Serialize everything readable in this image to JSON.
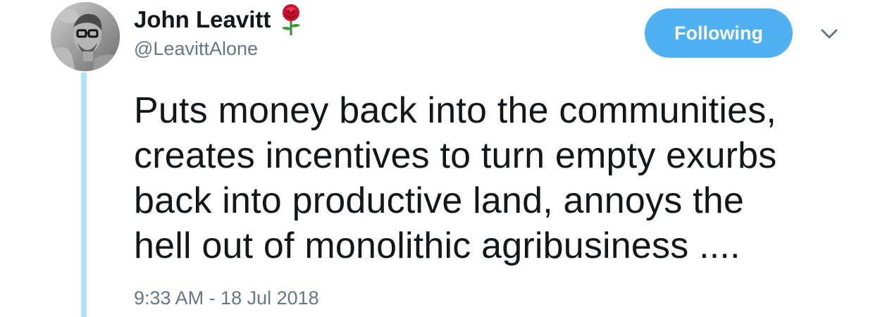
{
  "tweet": {
    "author": {
      "display_name": "John Leavitt",
      "handle": "@LeavittAlone",
      "name_emoji": "rose-icon"
    },
    "follow_button_label": "Following",
    "text_lines": [
      "Puts money back into the communities,",
      "creates incentives to turn empty exurbs",
      "back into productive land, annoys the",
      "hell out of monolithic agribusiness ...."
    ],
    "timestamp": "9:33 AM - 18 Jul 2018"
  },
  "colors": {
    "accent": "#4fb0f2",
    "thread_line": "#b2dffb",
    "muted_text": "#657786",
    "primary_text": "#14171a"
  }
}
